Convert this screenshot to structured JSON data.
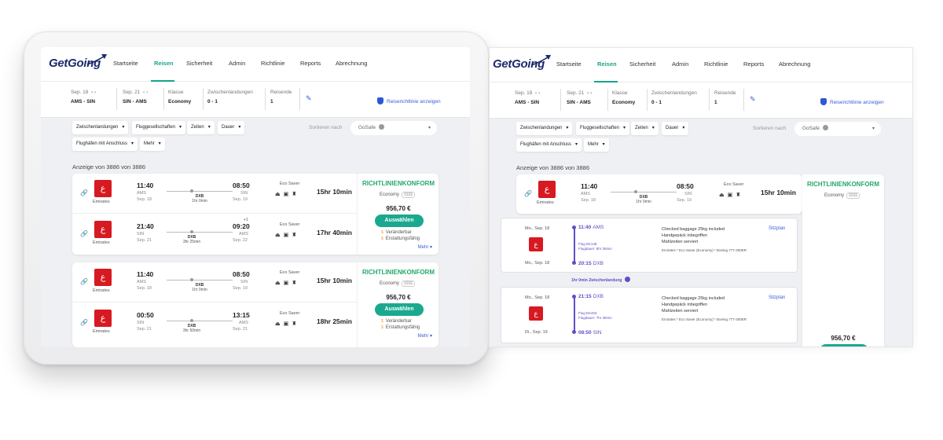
{
  "brand": "GetGoing",
  "nav": [
    "Startseite",
    "Reisen",
    "Sicherheit",
    "Admin",
    "Richtlinie",
    "Reports",
    "Abrechnung"
  ],
  "search": {
    "date1": "Sep. 18",
    "route1": "AMS - SIN",
    "date2": "Sep. 21",
    "route2": "SIN - AMS",
    "klasse_label": "Klasse",
    "klasse": "Economy",
    "zw_label": "Zwischenlandungen",
    "zw": "0 - 1",
    "reisende_label": "Reisende",
    "reisende": "1",
    "policy_link": "Reiserichtlinie anzeigen"
  },
  "filters": [
    "Zwischenlandungen",
    "Fluggesellschaften",
    "Zeiten",
    "Dauer",
    "Flughäfen mit Anschluss",
    "Mehr"
  ],
  "sort": {
    "label": "Sortieren nach",
    "value": "GoSafe"
  },
  "count": "Anzeige von 3886 von 3886",
  "results": [
    {
      "status": "RICHTLINIENKONFORM",
      "cabin": "Economy",
      "cost": "$$$$",
      "price": "956,70 €",
      "button": "Auswählen",
      "r1": "Veränderbar",
      "r2": "Erstattungsfähig",
      "mehr": "Mehr",
      "legs": [
        {
          "airline": "Emirates",
          "dep": "11:40",
          "dep_ap": "AMS",
          "dep_date": "Sep. 18",
          "via": "DXB",
          "via_dur": "1hr 0min",
          "arr": "08:50",
          "arr_ap": "SIN",
          "arr_date": "Sep. 19",
          "plus": "",
          "fare": "Eco Saver",
          "dur": "15hr 10min"
        },
        {
          "airline": "Emirates",
          "dep": "21:40",
          "dep_ap": "SIN",
          "dep_date": "Sep. 21",
          "via": "DXB",
          "via_dur": "3hr 25min",
          "arr": "09:20",
          "arr_ap": "AMS",
          "arr_date": "Sep. 22",
          "plus": "+1",
          "fare": "Eco Saver",
          "dur": "17hr 40min"
        }
      ]
    },
    {
      "status": "RICHTLINIENKONFORM",
      "cabin": "Economy",
      "cost": "$$$$",
      "price": "956,70 €",
      "button": "Auswählen",
      "r1": "Veränderbar",
      "r2": "Erstattungsfähig",
      "mehr": "Mehr",
      "legs": [
        {
          "airline": "Emirates",
          "dep": "11:40",
          "dep_ap": "AMS",
          "dep_date": "Sep. 18",
          "via": "DXB",
          "via_dur": "1hr 0min",
          "arr": "08:50",
          "arr_ap": "SIN",
          "arr_date": "Sep. 19",
          "plus": "",
          "fare": "Eco Saver",
          "dur": "15hr 10min"
        },
        {
          "airline": "Emirates",
          "dep": "00:50",
          "dep_ap": "SIN",
          "dep_date": "Sep. 21",
          "via": "DXB",
          "via_dur": "3hr 50min",
          "arr": "13:15",
          "arr_ap": "AMS",
          "arr_date": "Sep. 21",
          "plus": "",
          "fare": "Eco Saver",
          "dur": "18hr 25min"
        }
      ]
    }
  ],
  "detail": {
    "seg1": {
      "date": "Mo., Sep. 18",
      "date2": "Mo., Sep. 18",
      "dep": "11:40",
      "dep_ap": "AMS",
      "flight": "Flug EK148",
      "fdur": "Flugdauer: 6hr 35min",
      "arr": "20:15",
      "arr_ap": "DXB",
      "i1": "Checked baggage 25kg included",
      "i2": "Handgepäck inbegriffen",
      "i3": "Mahlzeiten serviert",
      "i4": "Emirates * Eco Saver (Economy) * Boeing 777-300ER",
      "seat": "Sitzplan"
    },
    "layover": "1hr 0min Zwischenlandung",
    "seg2": {
      "date": "Mo., Sep. 18",
      "date2": "Di., Sep. 19",
      "dep": "21:15",
      "dep_ap": "DXB",
      "flight": "Flug EK404",
      "fdur": "Flugdauer: 7hr 35min",
      "arr": "08:50",
      "arr_ap": "SIN",
      "i1": "Checked baggage 25kg included",
      "i2": "Handgepäck inbegriffen",
      "i3": "Mahlzeiten serviert",
      "i4": "Emirates * Eco Saver (Economy) * Boeing 777-300ER",
      "seat": "Sitzplan"
    },
    "price": "956,70 €"
  }
}
